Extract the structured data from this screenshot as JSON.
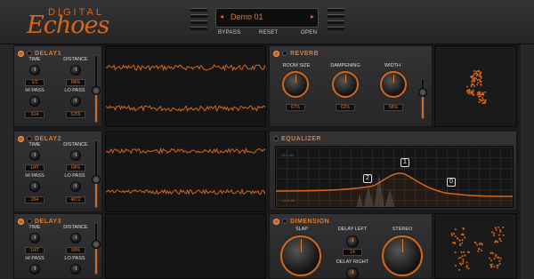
{
  "logo": {
    "digital": "DIGITAL",
    "echoes": "Echoes"
  },
  "preset": {
    "name": "Demo 01",
    "prev_icon": "left-triangle-icon",
    "next_icon": "right-triangle-icon"
  },
  "header_buttons": {
    "bypass": "BYPASS",
    "reset": "RESET",
    "open": "OPEN"
  },
  "delays": [
    {
      "title": "DELAY1",
      "time_label": "TIME",
      "time_value": "1/2",
      "distance_label": "DISTANCE",
      "distance_value": "84%",
      "hipass_label": "HI PASS",
      "hipass_value": "614",
      "lopass_label": "LO PASS",
      "lopass_value": "5255"
    },
    {
      "title": "DELAY2",
      "time_label": "TIME",
      "time_value": "1/4T",
      "distance_label": "DISTANCE",
      "distance_value": "64%",
      "hipass_label": "HI PASS",
      "hipass_value": "264",
      "lopass_label": "LO PASS",
      "lopass_value": "4872"
    },
    {
      "title": "DELAY3",
      "time_label": "TIME",
      "time_value": "1/4T",
      "distance_label": "DISTANCE",
      "distance_value": "90%",
      "hipass_label": "HI PASS",
      "hipass_value": "",
      "lopass_label": "LO PASS",
      "lopass_value": ""
    }
  ],
  "reverb": {
    "title": "REVERB",
    "room_label": "ROOM SIZE",
    "room_value": "67%",
    "damp_label": "DAMPENING",
    "damp_value": "62%",
    "width_label": "WIDTH",
    "width_value": "68%"
  },
  "equalizer": {
    "title": "EQUALIZER",
    "node1": "1",
    "node2": "2",
    "node0": "0",
    "band_top": "16.0 dB",
    "band_bottom": "-16.0 dB"
  },
  "dimension": {
    "title": "DIMENSION",
    "slap_label": "SLAP",
    "delay_left_label": "DELAY LEFT",
    "delay_left_value": "14",
    "delay_right_label": "DELAY RIGHT",
    "stereo_label": "STEREO"
  },
  "colors": {
    "accent": "#d5661d",
    "background": "#1b1b1c",
    "panel": "#2e2e30"
  }
}
